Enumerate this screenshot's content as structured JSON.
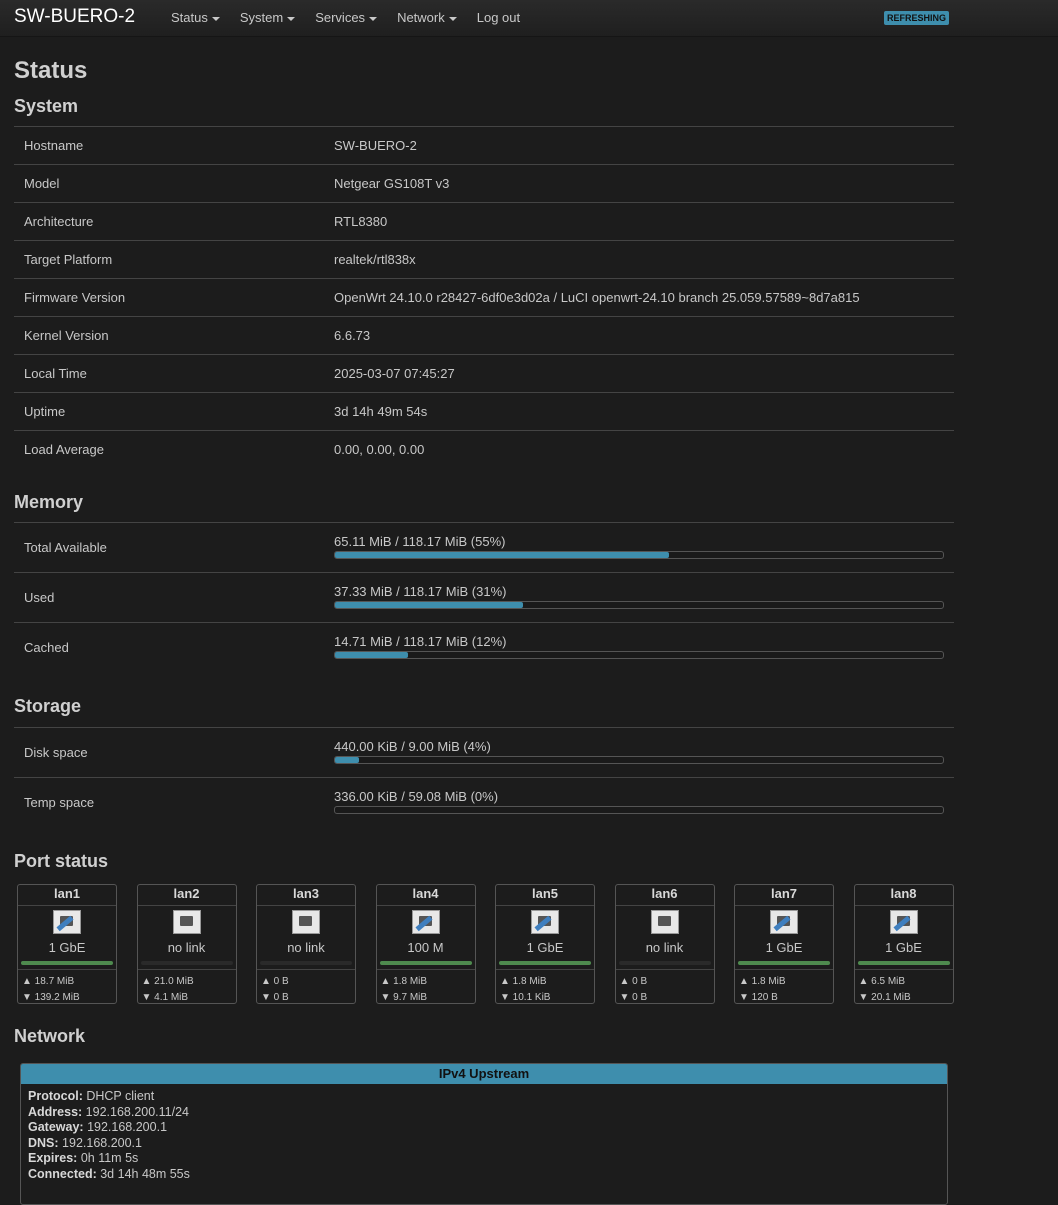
{
  "header": {
    "brand": "SW-BUERO-2",
    "menu": [
      "Status",
      "System",
      "Services",
      "Network"
    ],
    "logout": "Log out",
    "badge": "REFRESHING"
  },
  "page_title": "Status",
  "system": {
    "title": "System",
    "rows": [
      {
        "label": "Hostname",
        "value": "SW-BUERO-2"
      },
      {
        "label": "Model",
        "value": "Netgear GS108T v3"
      },
      {
        "label": "Architecture",
        "value": "RTL8380"
      },
      {
        "label": "Target Platform",
        "value": "realtek/rtl838x"
      },
      {
        "label": "Firmware Version",
        "value": "OpenWrt 24.10.0 r28427-6df0e3d02a / LuCI openwrt-24.10 branch 25.059.57589~8d7a815"
      },
      {
        "label": "Kernel Version",
        "value": "6.6.73"
      },
      {
        "label": "Local Time",
        "value": "2025-03-07 07:45:27"
      },
      {
        "label": "Uptime",
        "value": "3d 14h 49m 54s"
      },
      {
        "label": "Load Average",
        "value": "0.00, 0.00, 0.00"
      }
    ]
  },
  "memory": {
    "title": "Memory",
    "rows": [
      {
        "label": "Total Available",
        "value": "65.11 MiB / 118.17 MiB (55%)",
        "percent": 55
      },
      {
        "label": "Used",
        "value": "37.33 MiB / 118.17 MiB (31%)",
        "percent": 31
      },
      {
        "label": "Cached",
        "value": "14.71 MiB / 118.17 MiB (12%)",
        "percent": 12
      }
    ]
  },
  "storage": {
    "title": "Storage",
    "rows": [
      {
        "label": "Disk space",
        "value": "440.00 KiB / 9.00 MiB (4%)",
        "percent": 4
      },
      {
        "label": "Temp space",
        "value": "336.00 KiB / 59.08 MiB (0%)",
        "percent": 0
      }
    ]
  },
  "ports": {
    "title": "Port status",
    "items": [
      {
        "name": "lan1",
        "speed": "1 GbE",
        "link": true,
        "tx": "▲ 18.7 MiB",
        "rx": "▼ 139.2 MiB"
      },
      {
        "name": "lan2",
        "speed": "no link",
        "link": false,
        "tx": "▲ 21.0 MiB",
        "rx": "▼ 4.1 MiB"
      },
      {
        "name": "lan3",
        "speed": "no link",
        "link": false,
        "tx": "▲ 0 B",
        "rx": "▼ 0 B"
      },
      {
        "name": "lan4",
        "speed": "100 M",
        "link": true,
        "tx": "▲ 1.8 MiB",
        "rx": "▼ 9.7 MiB"
      },
      {
        "name": "lan5",
        "speed": "1 GbE",
        "link": true,
        "tx": "▲ 1.8 MiB",
        "rx": "▼ 10.1 KiB"
      },
      {
        "name": "lan6",
        "speed": "no link",
        "link": false,
        "tx": "▲ 0 B",
        "rx": "▼ 0 B"
      },
      {
        "name": "lan7",
        "speed": "1 GbE",
        "link": true,
        "tx": "▲ 1.8 MiB",
        "rx": "▼ 120 B"
      },
      {
        "name": "lan8",
        "speed": "1 GbE",
        "link": true,
        "tx": "▲ 6.5 MiB",
        "rx": "▼ 20.1 MiB"
      }
    ]
  },
  "network": {
    "title": "Network",
    "upstream_title": "IPv4 Upstream",
    "fields": [
      {
        "label": "Protocol:",
        "value": "DHCP client"
      },
      {
        "label": "Address:",
        "value": "192.168.200.11/24"
      },
      {
        "label": "Gateway:",
        "value": "192.168.200.1"
      },
      {
        "label": "DNS:",
        "value": "192.168.200.1"
      },
      {
        "label": "Expires:",
        "value": "0h 11m 5s"
      },
      {
        "label": "Connected:",
        "value": "3d 14h 48m 55s"
      }
    ]
  },
  "colors": {
    "accent": "#3e8ead",
    "link_up": "#4e8a4e",
    "background": "#1c1c1c"
  }
}
